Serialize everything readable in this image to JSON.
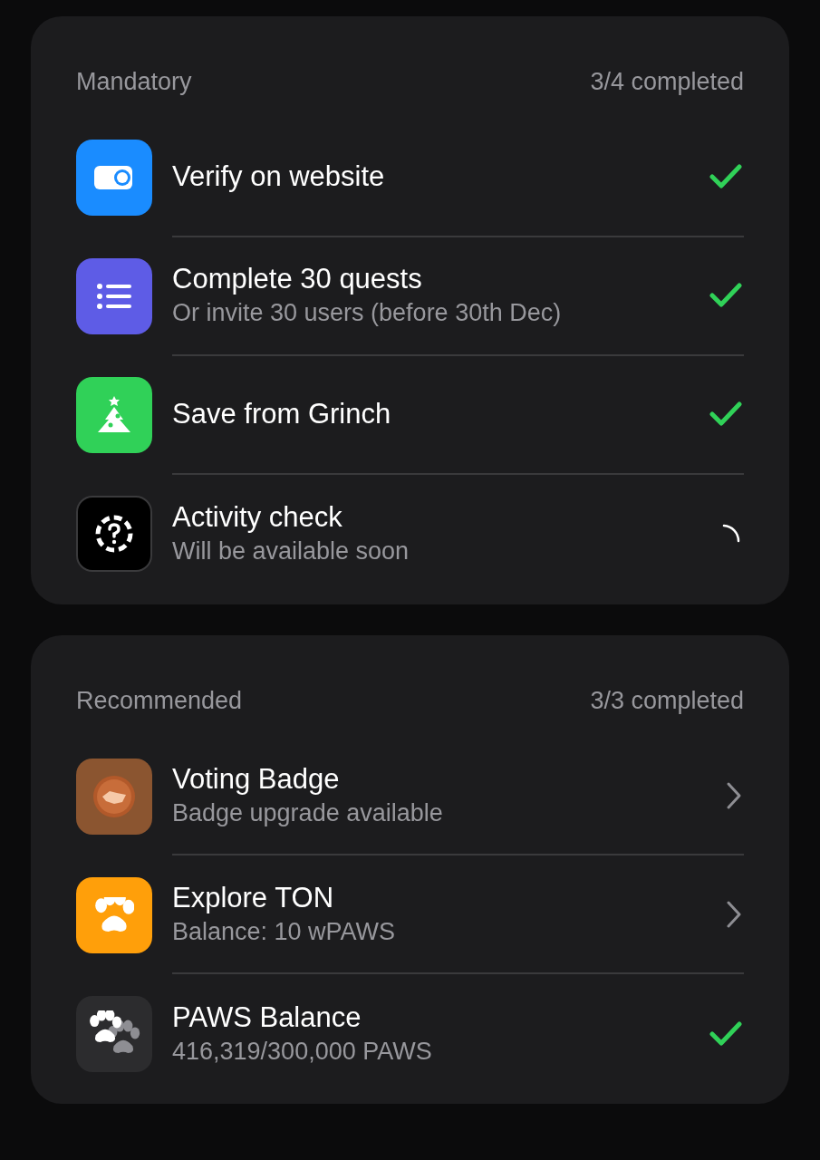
{
  "sections": [
    {
      "title": "Mandatory",
      "progress": "3/4 completed",
      "tasks": [
        {
          "kind": "wallet",
          "title": "Verify on website",
          "completed": true
        },
        {
          "kind": "list",
          "title": "Complete 30 quests",
          "subtitle": "Or invite 30 users (before 30th Dec)",
          "completed": true
        },
        {
          "kind": "tree",
          "title": "Save from Grinch",
          "completed": true
        },
        {
          "kind": "question",
          "title": "Activity check",
          "subtitle": "Will be available soon",
          "completed": false,
          "available": false
        }
      ]
    },
    {
      "title": "Recommended",
      "progress": "3/3 completed",
      "tasks": [
        {
          "kind": "badge",
          "title": "Voting Badge",
          "subtitle": "Badge upgrade available",
          "completed": false,
          "available": true
        },
        {
          "kind": "paw",
          "title": "Explore TON",
          "subtitle": "Balance: 10 wPAWS",
          "completed": false,
          "available": true
        },
        {
          "kind": "paws",
          "title": "PAWS Balance",
          "subtitle": "416,319/300,000 PAWS",
          "completed": true
        }
      ]
    }
  ]
}
